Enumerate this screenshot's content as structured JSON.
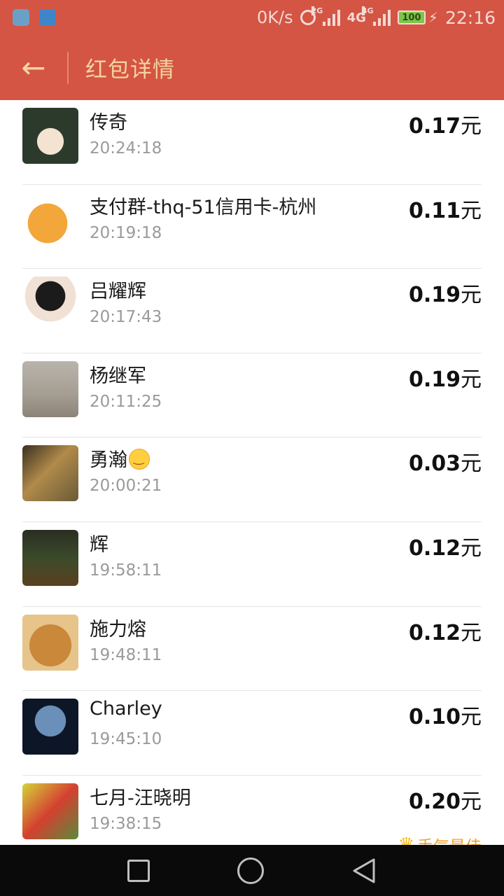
{
  "status_bar": {
    "network_speed": "0K/s",
    "network_2g": "2G",
    "network_4g": "4G",
    "network_4g_b": "4G",
    "battery": "100",
    "time": "22:16"
  },
  "header": {
    "back_icon": "arrow-left-icon",
    "title": "红包详情"
  },
  "list": [
    {
      "name": "传奇",
      "time": "20:24:18",
      "amount": "0.17",
      "unit": "元"
    },
    {
      "name": "支付群-thq-51信用卡-杭州",
      "time": "20:19:18",
      "amount": "0.11",
      "unit": "元"
    },
    {
      "name": "吕耀辉",
      "time": "20:17:43",
      "amount": "0.19",
      "unit": "元"
    },
    {
      "name": "杨继军",
      "time": "20:11:25",
      "amount": "0.19",
      "unit": "元"
    },
    {
      "name": "勇瀚",
      "time": "20:00:21",
      "amount": "0.03",
      "unit": "元"
    },
    {
      "name": "辉",
      "time": "19:58:11",
      "amount": "0.12",
      "unit": "元"
    },
    {
      "name": "施力熔",
      "time": "19:48:11",
      "amount": "0.12",
      "unit": "元"
    },
    {
      "name": "Charley",
      "time": "19:45:10",
      "amount": "0.10",
      "unit": "元"
    },
    {
      "name": "七月-汪晓明",
      "time": "19:38:15",
      "amount": "0.20",
      "unit": "元",
      "badge": "手气最佳"
    }
  ],
  "colors": {
    "header_bg": "#d45544",
    "header_text": "#f5d3a1",
    "badge": "#f0a02a"
  }
}
